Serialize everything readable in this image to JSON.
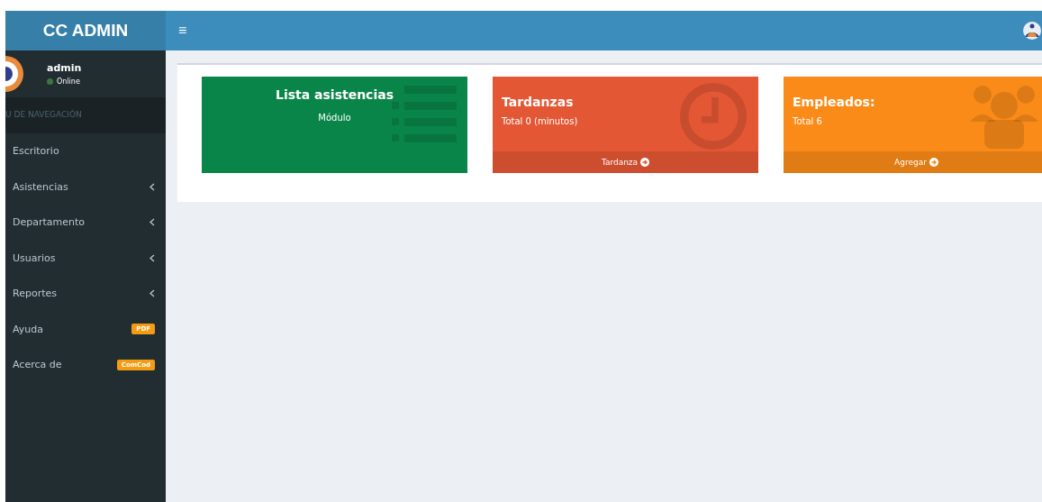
{
  "header": {
    "logo": "CC ADMIN",
    "menu_toggle": "≡"
  },
  "user": {
    "name": "admin",
    "status": "Online"
  },
  "sidebar": {
    "section_title": "U DE NAVEGACIÓN",
    "items": [
      {
        "label": "Escritorio",
        "expandable": false
      },
      {
        "label": "Asistencias",
        "expandable": true
      },
      {
        "label": "Departamento",
        "expandable": true
      },
      {
        "label": "Usuarios",
        "expandable": true
      },
      {
        "label": "Reportes",
        "expandable": true
      },
      {
        "label": "Ayuda",
        "expandable": false,
        "badge": "PDF"
      },
      {
        "label": "Acerca de",
        "expandable": false,
        "badge": "ComCod"
      }
    ]
  },
  "cards": [
    {
      "kind": "module",
      "title": "Lista asistencias",
      "subtitle": "Módulo",
      "color": "#0a8549"
    },
    {
      "kind": "stat",
      "title": "Tardanzas",
      "subtitle": "Total 0 (minutos)",
      "footer": "Tardanza",
      "color": "#e45735"
    },
    {
      "kind": "stat",
      "title": "Empleados:",
      "subtitle": "Total 6",
      "footer": "Agregar",
      "color": "#fb8b18"
    }
  ]
}
